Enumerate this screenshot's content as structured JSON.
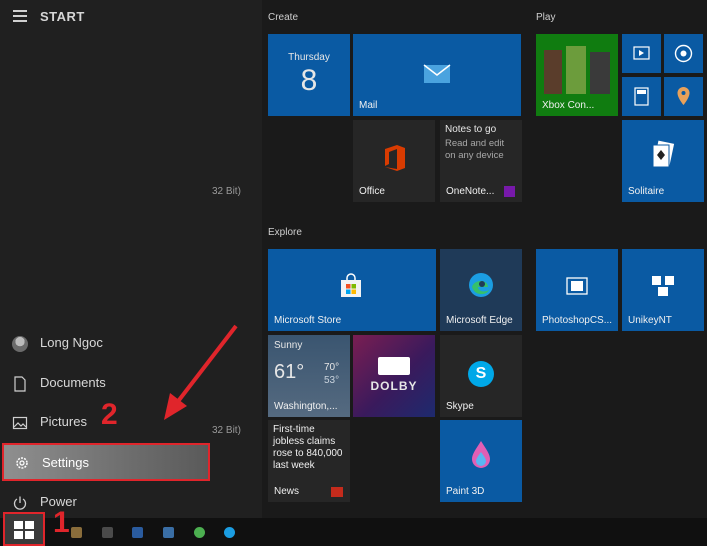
{
  "start": {
    "title": "START"
  },
  "background_text": {
    "line1": "32 Bit)",
    "line2": "32 Bit)"
  },
  "rail": {
    "user": "Long Ngoc",
    "documents": "Documents",
    "pictures": "Pictures",
    "settings": "Settings",
    "power": "Power"
  },
  "groups": {
    "create": "Create",
    "play": "Play",
    "explore": "Explore"
  },
  "tiles": {
    "calendar_day": "Thursday",
    "calendar_date": "8",
    "mail": "Mail",
    "xbox": "Xbox Con...",
    "notes_text": "Notes to go",
    "notes_sub": "Read and edit on any device",
    "office": "Office",
    "onenote": "OneNote...",
    "solitaire": "Solitaire",
    "store": "Microsoft Store",
    "edge": "Microsoft Edge",
    "photoshop": "PhotoshopCS...",
    "unikey": "UnikeyNT",
    "weather_cond": "Sunny",
    "weather_temp": "61°",
    "weather_high": "70°",
    "weather_low": "53°",
    "weather_city": "Washington,...",
    "dolby": "DOLBY",
    "skype": "Skype",
    "news_headline": "First-time jobless claims rose to 840,000 last week",
    "news": "News",
    "paint3d": "Paint 3D"
  },
  "annotations": {
    "step1": "1",
    "step2": "2"
  },
  "colors": {
    "accent": "#0a5aa3",
    "highlight": "#e0252b"
  }
}
